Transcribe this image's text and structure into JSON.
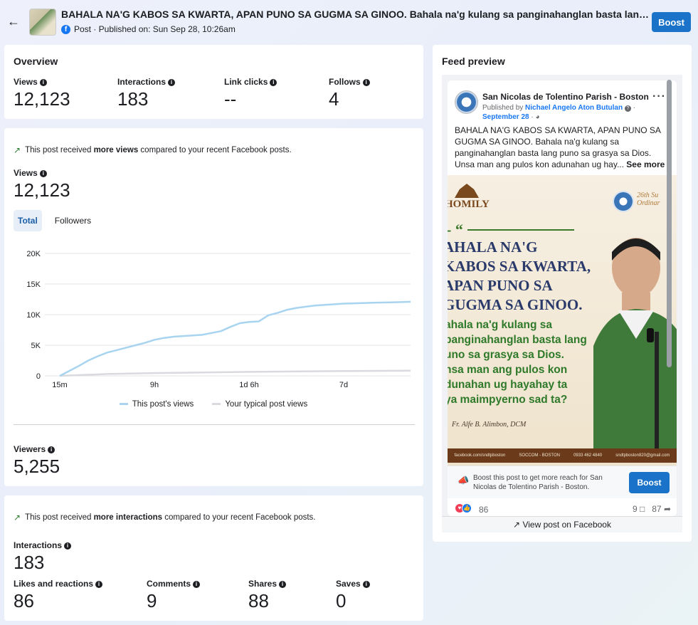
{
  "header": {
    "title": "BAHALA NA'G KABOS SA KWARTA, APAN PUNO SA GUGMA SA GINOO. Bahala na'g kulang sa panginahanglan basta lang puno sa grasya sa Dios. Unsa man ang pulos kon adunahan ug hayahay ta",
    "meta": "Post · Published on: Sun Sep 28, 10:26am",
    "boost_label": "Boost"
  },
  "overview": {
    "title": "Overview",
    "metrics": [
      {
        "label": "Views",
        "value": "12,123"
      },
      {
        "label": "Interactions",
        "value": "183"
      },
      {
        "label": "Link clicks",
        "value": "--"
      },
      {
        "label": "Follows",
        "value": "4"
      }
    ]
  },
  "views_section": {
    "trend_prefix": "This post received ",
    "trend_bold": "more views",
    "trend_suffix": " compared to your recent Facebook posts.",
    "views_label": "Views",
    "views_value": "12,123",
    "tabs": [
      "Total",
      "Followers"
    ],
    "active_tab": "Total",
    "legend": [
      "This post's views",
      "Your typical post views"
    ],
    "viewers_label": "Viewers",
    "viewers_value": "5,255"
  },
  "chart_data": {
    "type": "line",
    "x_ticks": [
      "15m",
      "9h",
      "1d 6h",
      "7d"
    ],
    "y_ticks": [
      "0",
      "5K",
      "10K",
      "15K",
      "20K"
    ],
    "ylim": [
      0,
      20000
    ],
    "xlim": [
      0,
      370
    ],
    "series": [
      {
        "name": "This post's views",
        "color": "#a8d4f0",
        "x": [
          0,
          10,
          20,
          30,
          40,
          50,
          60,
          70,
          80,
          90,
          100,
          110,
          120,
          130,
          140,
          150,
          160,
          170,
          180,
          190,
          200,
          210,
          215,
          220,
          230,
          240,
          250,
          260,
          270,
          280,
          290,
          300,
          310,
          320,
          330,
          340,
          350,
          360,
          370
        ],
        "y": [
          0,
          800,
          1600,
          2500,
          3200,
          3800,
          4200,
          4600,
          5000,
          5400,
          5900,
          6200,
          6400,
          6500,
          6600,
          6700,
          7000,
          7300,
          8000,
          8600,
          8800,
          8900,
          9400,
          9900,
          10300,
          10800,
          11100,
          11300,
          11500,
          11600,
          11700,
          11800,
          11850,
          11900,
          11950,
          11980,
          12000,
          12050,
          12100
        ]
      },
      {
        "name": "Your typical post views",
        "color": "#d8dadf",
        "x": [
          0,
          50,
          100,
          150,
          200,
          250,
          300,
          370
        ],
        "y": [
          0,
          300,
          450,
          550,
          650,
          720,
          780,
          850
        ]
      }
    ]
  },
  "interactions_section": {
    "trend_prefix": "This post received ",
    "trend_bold": "more interactions",
    "trend_suffix": " compared to your recent Facebook posts.",
    "label": "Interactions",
    "value": "183",
    "breakdown": [
      {
        "label": "Likes and reactions",
        "value": "86"
      },
      {
        "label": "Comments",
        "value": "9"
      },
      {
        "label": "Shares",
        "value": "88"
      },
      {
        "label": "Saves",
        "value": "0"
      }
    ]
  },
  "feed_preview": {
    "title": "Feed preview",
    "page_name": "San Nicolas de Tolentino Parish - Boston",
    "published_by_prefix": "Published by ",
    "publisher": "Nichael Angelo Aton Butulan",
    "date": "September 28",
    "text": "BAHALA NA'G KABOS SA KWARTA, APAN PUNO SA GUGMA SA GINOO. Bahala na'g kulang sa panginahanglan basta lang puno sa grasya sa Dios. Unsa man ang pulos kon adunahan ug hay...",
    "see_more": "See more",
    "image": {
      "homily": "HOMILY",
      "headline": "AHALA NA'G\nKABOS SA KWARTA,\nAPAN PUNO SA\nGUGMA SA GINOO.",
      "body": "ahala na'g kulang sa\npanginahanglan basta lang\nuno sa grasya sa Dios.\nnsa man ang pulos kon\ndunahan ug hayahay ta\nya maimpyerno sad ta?",
      "author": "Fr. Alfe B. Alimbon, DCM",
      "sunday": "26th Su\nOrdinar",
      "footer": [
        "facebook.com/sndtpboston",
        "SOCCOM - BOSTON",
        "0933 462 4840",
        "sndtpboston820@gmail.com"
      ]
    },
    "boost_text": "Boost this post to get more reach for San Nicolas de Tolentino Parish - Boston.",
    "boost_label": "Boost",
    "reactions": "86",
    "comments": "9",
    "shares": "87",
    "view_on_fb": "View post on Facebook"
  }
}
